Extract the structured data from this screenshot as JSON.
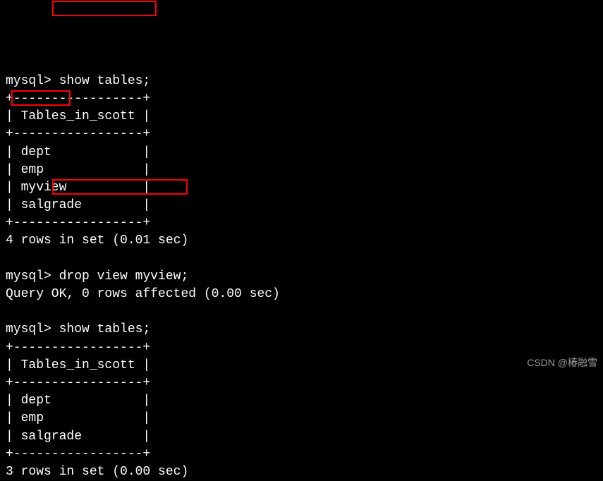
{
  "terminal": {
    "prompt": "mysql>",
    "cmd1": "show tables;",
    "tbl_border": "+-----------------+",
    "tbl_header": "| Tables_in_scott |",
    "tbl_row_dept": "| dept            |",
    "tbl_row_emp": "| emp             |",
    "tbl_row_myview": "| myview          |",
    "tbl_row_salgrade": "| salgrade        |",
    "result1": "4 rows in set (0.01 sec)",
    "cmd2": "drop view myview;",
    "result2": "Query OK, 0 rows affected (0.00 sec)",
    "cmd3": "show tables;",
    "tbl2_row_dept": "| dept            |",
    "tbl2_row_emp": "| emp             |",
    "tbl2_row_salgrade": "| salgrade        |",
    "result3": "3 rows in set (0.00 sec)"
  },
  "watermark": "CSDN @椿融雪"
}
